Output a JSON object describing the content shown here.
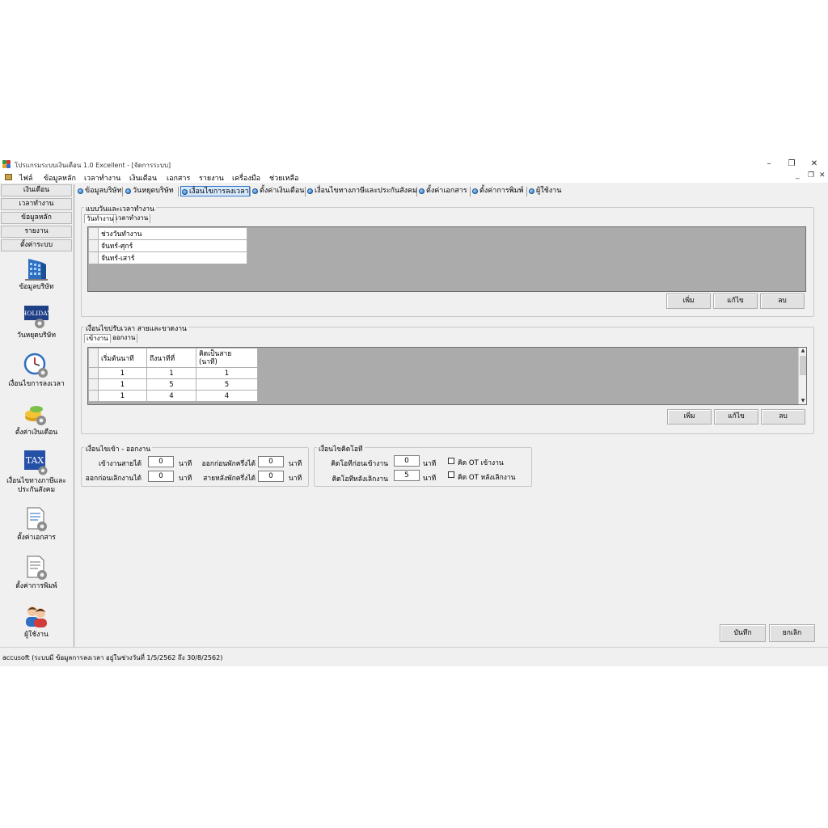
{
  "window": {
    "title": "โปรแกรมระบบเงินเดือน 1.0 Excellent - [จัดการระบบ]",
    "controls": [
      "–",
      "❐",
      "✕"
    ]
  },
  "menu": [
    "ไฟล์",
    "ข้อมูลหลัก",
    "เวลาทำงาน",
    "เงินเดือน",
    "เอกสาร",
    "รายงาน",
    "เครื่องมือ",
    "ช่วยเหลือ"
  ],
  "mdi_controls": [
    "_",
    "❐",
    "✕"
  ],
  "nav": {
    "buttons": [
      "เงินเดือน",
      "เวลาทำงาน",
      "ข้อมูลหลัก",
      "รายงาน",
      "ตั้งค่าระบบ"
    ],
    "tiles": [
      {
        "label": "ข้อมูลบริษัท",
        "icon": "building-icon"
      },
      {
        "label": "วันหยุดบริษัท",
        "icon": "holiday-gear-icon",
        "icon_text": "HOLIDAY"
      },
      {
        "label": "เงื่อนไขการลงเวลา",
        "icon": "clock-icon"
      },
      {
        "label": "ตั้งค่าเงินเดือน",
        "icon": "coins-gear-icon"
      },
      {
        "label": "เงื่อนไขทางภาษีและประกันสังคม",
        "label_lines": [
          "เงื่อนไขทางภาษีและ",
          "ประกันสังคม"
        ],
        "icon": "tax-icon",
        "icon_text": "TAX"
      },
      {
        "label": "ตั้งค่าเอกสาร",
        "icon": "document-gear-icon"
      },
      {
        "label": "ตั้งค่าการพิมพ์",
        "icon": "print-settings-icon"
      },
      {
        "label": "ผู้ใช้งาน",
        "icon": "users-icon"
      }
    ]
  },
  "tabs": [
    "ข้อมูลบริษัท",
    "วันหยุดบริษัท",
    "เงื่อนไขการลงเวลา",
    "ตั้งค่าเงินเดือน",
    "เงื่อนไขทางภาษีและประกันสังคม",
    "ตั้งค่าเอกสาร",
    "ตั้งค่าการพิมพ์",
    "ผู้ใช้งาน"
  ],
  "active_tab": "เงื่อนไขการลงเวลา",
  "work_schedule": {
    "title": "แบบวันและเวลาทำงาน",
    "subtabs": [
      "วันทำงาน",
      "เวลาทำงาน"
    ],
    "column": "ช่วงวันทำงาน",
    "rows": [
      "จันทร์-ศุกร์",
      "จันทร์-เสาร์"
    ],
    "buttons": {
      "add": "เพิ่ม",
      "edit": "แก้ไข",
      "delete": "ลบ"
    }
  },
  "late_rules": {
    "title": "เงื่อนไขปรับเวลา สายและขาดงาน",
    "subtabs": [
      "เข้างาน",
      "ออกงาน"
    ],
    "columns": [
      "เริ่มต้นนาที",
      "ถึงนาทีที่",
      "คิดเป็นสาย\n(นาที)"
    ],
    "rows": [
      [
        "1",
        "1",
        "1"
      ],
      [
        "1",
        "5",
        "5"
      ],
      [
        "1",
        "4",
        "4"
      ]
    ],
    "buttons": {
      "add": "เพิ่ม",
      "edit": "แก้ไข",
      "delete": "ลบ"
    }
  },
  "inout": {
    "title": "เงื่อนไขเข้า - ออกงาน",
    "late_in_label": "เข้างานสายได้",
    "late_in_value": "0",
    "early_out_label": "ออกก่อนเลิกงานได้",
    "early_out_value": "0",
    "break_out_label": "ออกก่อนพักครึ่งได้",
    "break_out_value": "0",
    "break_late_label": "สายหลังพักครึ่งได้",
    "break_late_value": "0",
    "unit": "นาที"
  },
  "ot": {
    "title": "เงื่อนไขคิดโอที",
    "before_label": "คิดโอทีก่อนเข้างาน",
    "before_value": "0",
    "after_label": "คิดโอทีหลังเลิกงาน",
    "after_value": "5",
    "unit": "นาที",
    "chk_before_label": "คิด OT เข้างาน",
    "chk_after_label": "คิด OT หลังเลิกงาน"
  },
  "footer_buttons": {
    "save": "บันทึก",
    "cancel": "ยกเลิก"
  },
  "status": "accusoft (ระบบมี ข้อมูลการลงเวลา อยู่ในช่วงวันที่ 1/5/2562 ถึง 30/8/2562)"
}
